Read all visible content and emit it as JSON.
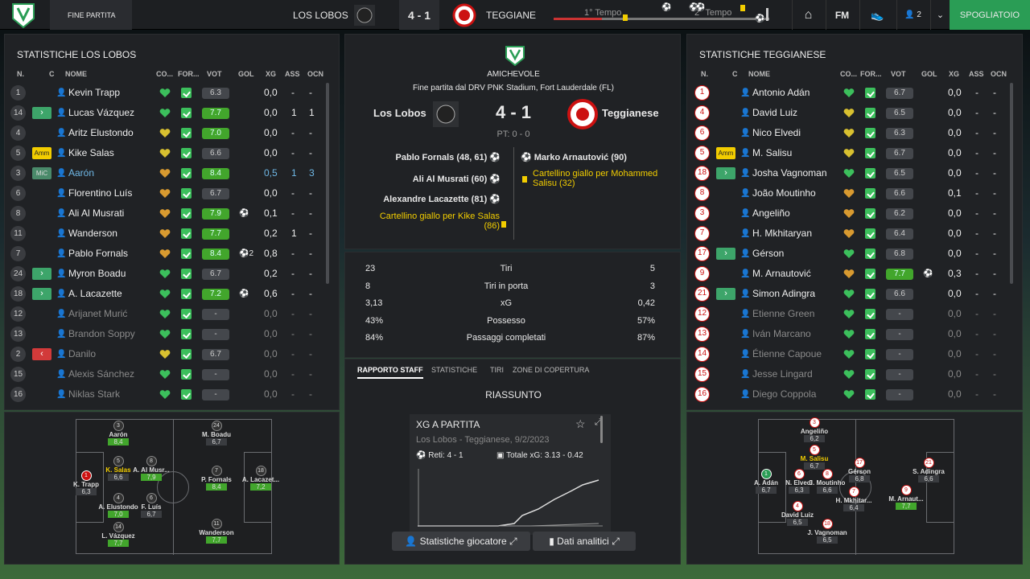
{
  "topbar": {
    "tab": "FINE PARTITA",
    "home_team": "LOS LOBOS",
    "score": "4 - 1",
    "away_team": "TEGGIANESE",
    "half1": "1° Tempo",
    "half2": "2° Tempo",
    "fm": "FM",
    "users": "2",
    "dressing": "SPOGLIATOIO"
  },
  "home": {
    "title": "STATISTICHE LOS LOBOS",
    "headers": {
      "n": "N.",
      "c": "C",
      "name": "NOME",
      "co": "CO...",
      "for": "FOR...",
      "vot": "VOT",
      "gol": "GOL",
      "xg": "XG",
      "ass": "ASS",
      "ocn": "OCN"
    },
    "players": [
      {
        "n": "1",
        "chip": "",
        "name": "Kevin Trapp",
        "vote": "6.3",
        "gol": "",
        "xg": "0,0",
        "ass": "-",
        "ocn": "-",
        "hc": "g"
      },
      {
        "n": "14",
        "chip": "in",
        "name": "Lucas Vázquez",
        "vote": "7.7",
        "gol": "",
        "xg": "0,0",
        "ass": "1",
        "ocn": "1",
        "hc": "g"
      },
      {
        "n": "4",
        "chip": "",
        "name": "Aritz Elustondo",
        "vote": "7.0",
        "gol": "",
        "xg": "0,0",
        "ass": "-",
        "ocn": "-",
        "hc": "y"
      },
      {
        "n": "5",
        "chip": "Amm",
        "name": "Kike Salas",
        "vote": "6.6",
        "gol": "",
        "xg": "0,0",
        "ass": "-",
        "ocn": "-",
        "hc": "y"
      },
      {
        "n": "3",
        "chip": "MiC",
        "name": "Aarón",
        "vote": "8.4",
        "gol": "",
        "xg": "0,5",
        "ass": "1",
        "ocn": "3",
        "hc": "o"
      },
      {
        "n": "6",
        "chip": "",
        "name": "Florentino Luís",
        "vote": "6.7",
        "gol": "",
        "xg": "0,0",
        "ass": "-",
        "ocn": "-",
        "hc": "o"
      },
      {
        "n": "8",
        "chip": "",
        "name": "Ali Al Musrati",
        "vote": "7.9",
        "gol": "⚽",
        "xg": "0,1",
        "ass": "-",
        "ocn": "-",
        "hc": "o"
      },
      {
        "n": "11",
        "chip": "",
        "name": "Wanderson",
        "vote": "7.7",
        "gol": "",
        "xg": "0,2",
        "ass": "1",
        "ocn": "-",
        "hc": "o"
      },
      {
        "n": "7",
        "chip": "",
        "name": "Pablo Fornals",
        "vote": "8.4",
        "gol": "⚽2",
        "xg": "0,8",
        "ass": "-",
        "ocn": "-",
        "hc": "o"
      },
      {
        "n": "24",
        "chip": "in",
        "name": "Myron Boadu",
        "vote": "6.7",
        "gol": "",
        "xg": "0,2",
        "ass": "-",
        "ocn": "-",
        "hc": "g"
      },
      {
        "n": "18",
        "chip": "in",
        "name": "A. Lacazette",
        "vote": "7.2",
        "gol": "⚽",
        "xg": "0,6",
        "ass": "-",
        "ocn": "-",
        "hc": "g"
      },
      {
        "n": "12",
        "chip": "",
        "name": "Arijanet Murić",
        "vote": "-",
        "gol": "",
        "xg": "0,0",
        "ass": "-",
        "ocn": "-",
        "hc": "g",
        "dim": true
      },
      {
        "n": "13",
        "chip": "",
        "name": "Brandon Soppy",
        "vote": "-",
        "gol": "",
        "xg": "0,0",
        "ass": "-",
        "ocn": "-",
        "hc": "g",
        "dim": true
      },
      {
        "n": "2",
        "chip": "out",
        "name": "Danilo",
        "vote": "6.7",
        "gol": "",
        "xg": "0,0",
        "ass": "-",
        "ocn": "-",
        "hc": "y",
        "dim": true
      },
      {
        "n": "15",
        "chip": "",
        "name": "Alexis Sánchez",
        "vote": "-",
        "gol": "",
        "xg": "0,0",
        "ass": "-",
        "ocn": "-",
        "hc": "g",
        "dim": true
      },
      {
        "n": "16",
        "chip": "",
        "name": "Niklas Stark",
        "vote": "-",
        "gol": "",
        "xg": "0,0",
        "ass": "-",
        "ocn": "-",
        "hc": "g",
        "dim": true
      }
    ]
  },
  "away": {
    "title": "STATISTICHE TEGGIANESE",
    "headers": {
      "n": "N.",
      "c": "C",
      "name": "NOME",
      "co": "CO...",
      "for": "FOR...",
      "vot": "VOT",
      "gol": "GOL",
      "xg": "XG",
      "ass": "ASS",
      "ocn": "OCN"
    },
    "players": [
      {
        "n": "1",
        "chip": "",
        "name": "Antonio Adán",
        "vote": "6.7",
        "gol": "",
        "xg": "0,0",
        "ass": "-",
        "ocn": "-",
        "hc": "g"
      },
      {
        "n": "4",
        "chip": "",
        "name": "David Luiz",
        "vote": "6.5",
        "gol": "",
        "xg": "0,0",
        "ass": "-",
        "ocn": "-",
        "hc": "y"
      },
      {
        "n": "6",
        "chip": "",
        "name": "Nico Elvedi",
        "vote": "6.3",
        "gol": "",
        "xg": "0,0",
        "ass": "-",
        "ocn": "-",
        "hc": "y"
      },
      {
        "n": "5",
        "chip": "Amm",
        "name": "M. Salisu",
        "vote": "6.7",
        "gol": "",
        "xg": "0,0",
        "ass": "-",
        "ocn": "-",
        "hc": "y"
      },
      {
        "n": "18",
        "chip": "in",
        "name": "Josha Vagnoman",
        "vote": "6.5",
        "gol": "",
        "xg": "0,0",
        "ass": "-",
        "ocn": "-",
        "hc": "g"
      },
      {
        "n": "8",
        "chip": "",
        "name": "João Moutinho",
        "vote": "6.6",
        "gol": "",
        "xg": "0,1",
        "ass": "-",
        "ocn": "-",
        "hc": "o"
      },
      {
        "n": "3",
        "chip": "",
        "name": "Angeliño",
        "vote": "6.2",
        "gol": "",
        "xg": "0,0",
        "ass": "-",
        "ocn": "-",
        "hc": "o"
      },
      {
        "n": "7",
        "chip": "",
        "name": "H. Mkhitaryan",
        "vote": "6.4",
        "gol": "",
        "xg": "0,0",
        "ass": "-",
        "ocn": "-",
        "hc": "o"
      },
      {
        "n": "17",
        "chip": "in",
        "name": "Gérson",
        "vote": "6.8",
        "gol": "",
        "xg": "0,0",
        "ass": "-",
        "ocn": "-",
        "hc": "g"
      },
      {
        "n": "9",
        "chip": "",
        "name": "M. Arnautović",
        "vote": "7.7",
        "gol": "⚽",
        "xg": "0,3",
        "ass": "-",
        "ocn": "-",
        "hc": "o"
      },
      {
        "n": "21",
        "chip": "in",
        "name": "Simon Adingra",
        "vote": "6.6",
        "gol": "",
        "xg": "0,0",
        "ass": "-",
        "ocn": "-",
        "hc": "g"
      },
      {
        "n": "12",
        "chip": "",
        "name": "Etienne Green",
        "vote": "-",
        "gol": "",
        "xg": "0,0",
        "ass": "-",
        "ocn": "-",
        "hc": "g",
        "dim": true
      },
      {
        "n": "13",
        "chip": "",
        "name": "Iván Marcano",
        "vote": "-",
        "gol": "",
        "xg": "0,0",
        "ass": "-",
        "ocn": "-",
        "hc": "g",
        "dim": true
      },
      {
        "n": "14",
        "chip": "",
        "name": "Étienne Capoue",
        "vote": "-",
        "gol": "",
        "xg": "0,0",
        "ass": "-",
        "ocn": "-",
        "hc": "g",
        "dim": true
      },
      {
        "n": "15",
        "chip": "",
        "name": "Jesse Lingard",
        "vote": "-",
        "gol": "",
        "xg": "0,0",
        "ass": "-",
        "ocn": "-",
        "hc": "g",
        "dim": true
      },
      {
        "n": "16",
        "chip": "",
        "name": "Diego Coppola",
        "vote": "-",
        "gol": "",
        "xg": "0,0",
        "ass": "-",
        "ocn": "-",
        "hc": "g",
        "dim": true
      }
    ]
  },
  "center": {
    "competition": "AMICHEVOLE",
    "venue": "Fine partita dal DRV PNK Stadium, Fort Lauderdale (FL)",
    "home": "Los Lobos",
    "away": "Teggianese",
    "score": "4 - 1",
    "pt": "PT: 0 - 0",
    "home_events": [
      "Pablo Fornals (48, 61)",
      "Ali Al Musrati (60)",
      "Alexandre Lacazette (81)"
    ],
    "home_card": "Cartellino giallo per Kike Salas (86)",
    "away_goal": "Marko Arnautović (90)",
    "away_card": "Cartellino giallo per Mohammed Salisu (32)",
    "stats": [
      {
        "h": "23",
        "l": "Tiri",
        "a": "5"
      },
      {
        "h": "8",
        "l": "Tiri in porta",
        "a": "3"
      },
      {
        "h": "3,13",
        "l": "xG",
        "a": "0,42"
      },
      {
        "h": "43%",
        "l": "Possesso",
        "a": "57%"
      },
      {
        "h": "84%",
        "l": "Passaggi completati",
        "a": "87%"
      }
    ],
    "tabs": [
      "RAPPORTO STAFF",
      "STATISTICHE",
      "TIRI",
      "ZONE DI COPERTURA"
    ],
    "summary": "RIASSUNTO",
    "card_title": "XG A PARTITA",
    "card_sub": "Los Lobos - Teggianese, 9/2/2023",
    "reti": "Reti: 4 - 1",
    "totale": "Totale xG: 3.13 - 0.42",
    "btn1": "Statistiche giocatore",
    "btn2": "Dati analitici"
  },
  "pitch_home": [
    {
      "n": "1",
      "name": "K. Trapp",
      "v": "6,3",
      "g": false,
      "red": true
    },
    {
      "n": "3",
      "name": "Aarón",
      "v": "8,4",
      "g": true
    },
    {
      "n": "5",
      "name": "K. Salas",
      "v": "6,6",
      "g": false,
      "y": true
    },
    {
      "n": "8",
      "name": "A. Al Musr...",
      "v": "7,9",
      "g": true
    },
    {
      "n": "4",
      "name": "A. Elustondo",
      "v": "7,0",
      "g": true
    },
    {
      "n": "6",
      "name": "F. Luís",
      "v": "6,7",
      "g": false
    },
    {
      "n": "14",
      "name": "L. Vázquez",
      "v": "7,7",
      "g": true
    },
    {
      "n": "24",
      "name": "M. Boadu",
      "v": "6,7",
      "g": false
    },
    {
      "n": "7",
      "name": "P. Fornals",
      "v": "8,4",
      "g": true
    },
    {
      "n": "11",
      "name": "Wanderson",
      "v": "7,7",
      "g": true
    },
    {
      "n": "18",
      "name": "A. Lacazet...",
      "v": "7,2",
      "g": true
    }
  ],
  "pitch_away": [
    {
      "n": "3",
      "name": "Angeliño",
      "v": "6,2"
    },
    {
      "n": "5",
      "name": "M. Salisu",
      "v": "6,7",
      "y": true
    },
    {
      "n": "17",
      "name": "Gérson",
      "v": "6,8"
    },
    {
      "n": "21",
      "name": "S. Adingra",
      "v": "6,6"
    },
    {
      "n": "1",
      "name": "A. Adán",
      "v": "6,7",
      "gk": true
    },
    {
      "n": "6",
      "name": "N. Elvedi",
      "v": "6,3"
    },
    {
      "n": "8",
      "name": "J. Moutinho",
      "v": "6,6"
    },
    {
      "n": "7",
      "name": "H. Mkhitar...",
      "v": "6,4"
    },
    {
      "n": "9",
      "name": "M. Arnaut...",
      "v": "7,7",
      "g": true
    },
    {
      "n": "4",
      "name": "David Luiz",
      "v": "6,5"
    },
    {
      "n": "18",
      "name": "J. Vagnoman",
      "v": "6,5"
    }
  ]
}
